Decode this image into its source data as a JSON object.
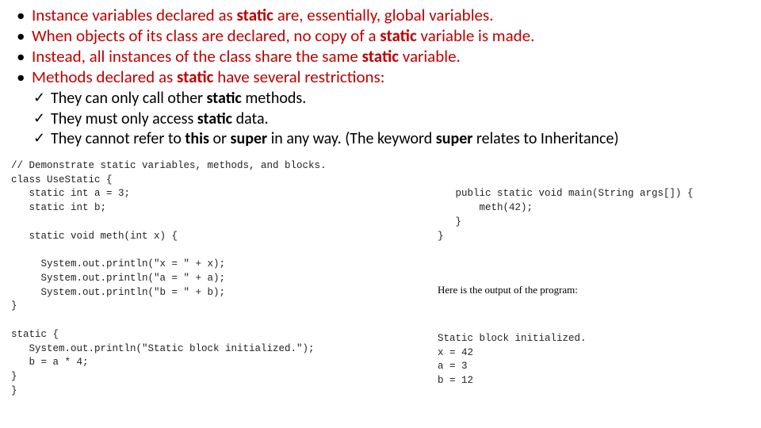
{
  "bullets": [
    {
      "pre": "Instance variables declared as ",
      "bold": "static",
      "post": " are, essentially, global variables."
    },
    {
      "pre": "When objects of its class are declared, no copy of a ",
      "bold": "static",
      "post": " variable is made."
    },
    {
      "pre": "Instead, all instances of the class share the same ",
      "bold": "static",
      "post": " variable."
    },
    {
      "pre": "Methods declared as ",
      "bold": "static",
      "post": " have several restrictions:"
    }
  ],
  "subs": [
    {
      "t0": "They can only call other ",
      "b0": "static",
      "t1": " methods.",
      "b1": "",
      "t2": ""
    },
    {
      "t0": "They must only access ",
      "b0": "static",
      "t1": " data.",
      "b1": "",
      "t2": ""
    },
    {
      "t0": "They cannot refer to ",
      "b0": "this",
      "t1": " or ",
      "b1": "super",
      "t2": " in any way. (The keyword ",
      "b2": "super",
      "t3": " relates to Inheritance)"
    }
  ],
  "code_left": "// Demonstrate static variables, methods, and blocks.\nclass UseStatic {\n   static int a = 3;\n   static int b;\n\n   static void meth(int x) {\n\n     System.out.println(\"x = \" + x);\n     System.out.println(\"a = \" + a);\n     System.out.println(\"b = \" + b);\n}\n\nstatic {\n   System.out.println(\"Static block initialized.\");\n   b = a * 4;\n}\n}",
  "code_right_top": "   public static void main(String args[]) {\n       meth(42);\n   }\n}",
  "output_caption": "Here is the output of the program:",
  "code_right_out": "Static block initialized.\nx = 42\na = 3\nb = 12"
}
